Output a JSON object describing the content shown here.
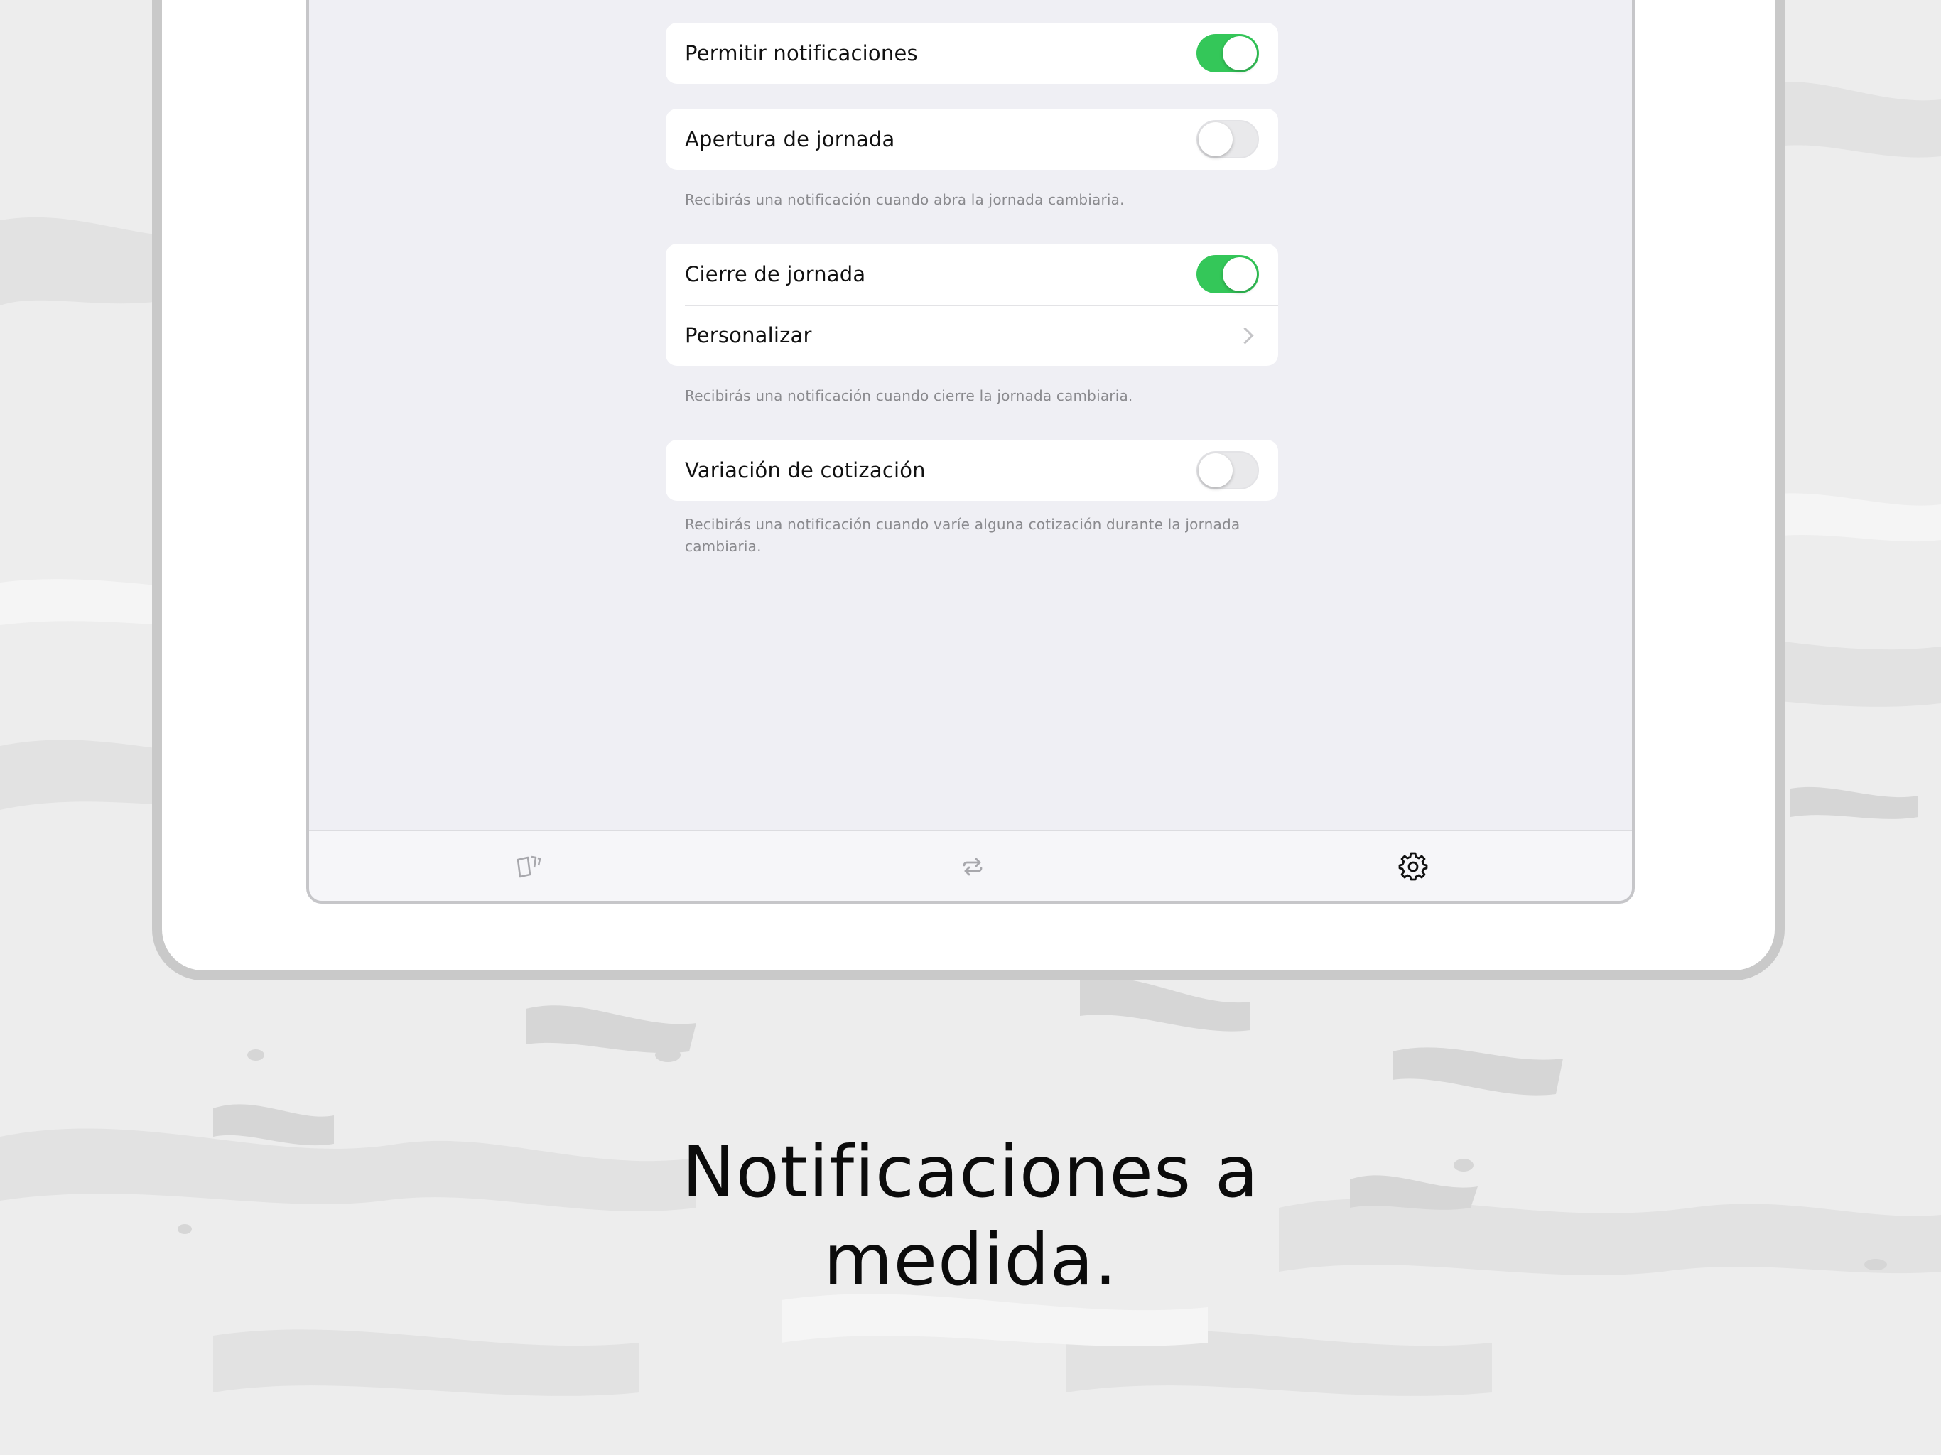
{
  "settings": {
    "groups": [
      {
        "rows": [
          {
            "label": "Permitir notificaciones",
            "control": "toggle",
            "on": true
          }
        ]
      },
      {
        "rows": [
          {
            "label": "Apertura de jornada",
            "control": "toggle",
            "on": false
          }
        ],
        "footnote": "Recibirás una notificación cuando abra la jornada cambiaria."
      },
      {
        "rows": [
          {
            "label": "Cierre de jornada",
            "control": "toggle",
            "on": true
          },
          {
            "label": "Personalizar",
            "control": "chevron"
          }
        ],
        "footnote": "Recibirás una notificación cuando cierre la jornada cambiaria."
      },
      {
        "rows": [
          {
            "label": "Variación de cotización",
            "control": "toggle",
            "on": false
          }
        ],
        "footnote": "Recibirás una notificación cuando varíe alguna cotización durante la jornada cambiaria."
      }
    ]
  },
  "tabbar": {
    "tabs": [
      {
        "icon": "cards-icon",
        "selected": false
      },
      {
        "icon": "exchange-arrows-icon",
        "selected": false
      },
      {
        "icon": "gear-icon",
        "selected": true
      }
    ]
  },
  "caption": {
    "line1": "Notificaciones a",
    "line2": "medida."
  },
  "colors": {
    "toggle_on": "#34c759",
    "toggle_off": "#e9e9eb",
    "screen_bg": "#efeff4",
    "tab_selected": "#111111",
    "tab_unselected": "#a8a8ad"
  }
}
